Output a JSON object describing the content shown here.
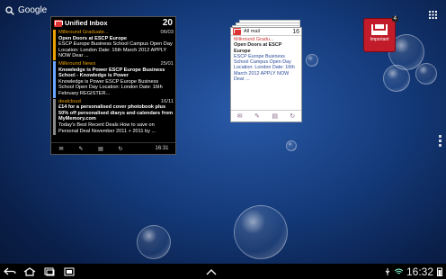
{
  "search": {
    "label": "Google"
  },
  "widget_unified": {
    "title": "Unified Inbox",
    "count": "20",
    "messages": [
      {
        "from": "Milkround Graduate...",
        "date": "06/03",
        "subject": "Open Doors at ESCP Europe",
        "preview": "ESCP Europe Business School Campus Open Day Location: London Date: 16th March 2012 APPLY NOW Dear ..."
      },
      {
        "from": "Milkround News",
        "date": "25/01",
        "subject": "Knowledge is Power ESCP Europe Business School - Knowledge is Power",
        "preview": "Knowledge is Power ESCP Europe Business School Open Day Location: London Date: 16th February REGISTER..."
      },
      {
        "from": "dealcloud",
        "date": "16/11",
        "subject": "£14 for a personalised cover photobook plus 50% off personalised diarys and calendars from MyMemory.com",
        "preview": "Today's Best Recent Deals How to save on Personal Deal November 2011 + 2011 by ..."
      }
    ],
    "time": "16:31"
  },
  "widget_all": {
    "title": "All mail",
    "count": "16",
    "from": "Milkround Gradu...",
    "subject": "Open Doors at ESCP Europe",
    "preview": "ESCP Europe Business School Campus Open Day Location: London Date: 16th March 2012 APPLY NOW Dear ..."
  },
  "important": {
    "label": "Important",
    "badge": "4"
  },
  "statusbar": {
    "time": "16:32"
  },
  "colors": {
    "accent_orange": "#e8a000",
    "gmail_red": "#c21c2a"
  }
}
